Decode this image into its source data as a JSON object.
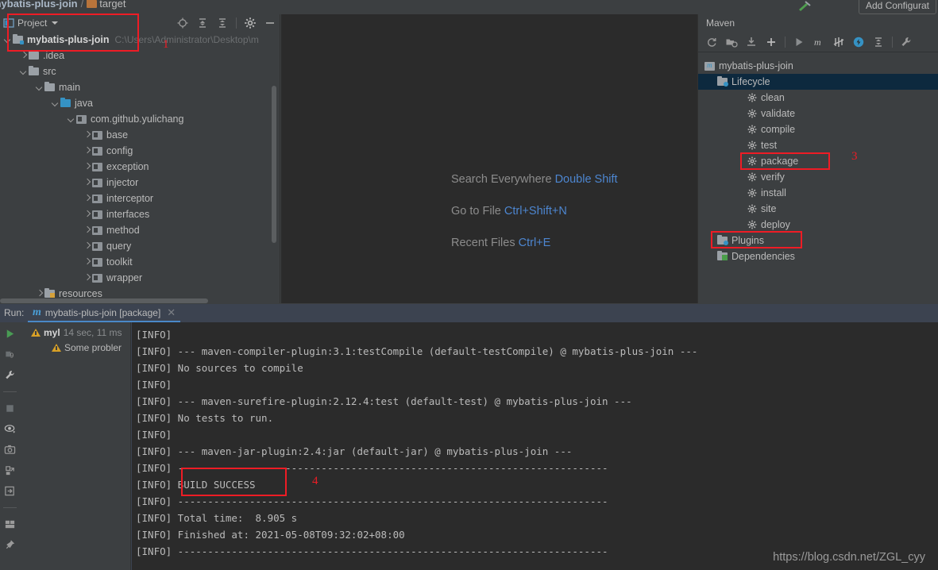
{
  "breadcrumb": {
    "project": "mybatis-plus-join",
    "separator": "/",
    "target": "target"
  },
  "toolbar": {
    "add_configuration": "Add Configurat",
    "hammer_icon": "build-hammer-icon"
  },
  "project_panel": {
    "title": "Project",
    "icons": [
      "locate-icon",
      "expand-all-icon",
      "collapse-all-icon",
      "settings-gear-icon",
      "hide-minimize-icon"
    ],
    "root": {
      "label": "mybatis-plus-join",
      "path": "C:\\Users\\Administrator\\Desktop\\m"
    },
    "items": [
      {
        "label": ".idea",
        "indent": 2,
        "arrow": "right",
        "icon": "folder-grey"
      },
      {
        "label": "src",
        "indent": 2,
        "arrow": "down",
        "icon": "folder-grey"
      },
      {
        "label": "main",
        "indent": 3,
        "arrow": "down",
        "icon": "folder-grey"
      },
      {
        "label": "java",
        "indent": 4,
        "arrow": "down",
        "icon": "folder-blue"
      },
      {
        "label": "com.github.yulichang",
        "indent": 5,
        "arrow": "down",
        "icon": "package"
      },
      {
        "label": "base",
        "indent": 6,
        "arrow": "right",
        "icon": "package"
      },
      {
        "label": "config",
        "indent": 6,
        "arrow": "right",
        "icon": "package"
      },
      {
        "label": "exception",
        "indent": 6,
        "arrow": "right",
        "icon": "package"
      },
      {
        "label": "injector",
        "indent": 6,
        "arrow": "right",
        "icon": "package"
      },
      {
        "label": "interceptor",
        "indent": 6,
        "arrow": "right",
        "icon": "package"
      },
      {
        "label": "interfaces",
        "indent": 6,
        "arrow": "right",
        "icon": "package"
      },
      {
        "label": "method",
        "indent": 6,
        "arrow": "right",
        "icon": "package"
      },
      {
        "label": "query",
        "indent": 6,
        "arrow": "right",
        "icon": "package"
      },
      {
        "label": "toolkit",
        "indent": 6,
        "arrow": "right",
        "icon": "package"
      },
      {
        "label": "wrapper",
        "indent": 6,
        "arrow": "right",
        "icon": "package"
      },
      {
        "label": "resources",
        "indent": 3,
        "arrow": "right",
        "icon": "folder-resources"
      }
    ]
  },
  "editor": {
    "shortcuts": [
      {
        "action": "Search Everywhere",
        "key": "Double Shift"
      },
      {
        "action": "Go to File",
        "key": "Ctrl+Shift+N"
      },
      {
        "action": "Recent Files",
        "key": "Ctrl+E"
      }
    ]
  },
  "maven_panel": {
    "title": "Maven",
    "toolbar_icons": [
      "reload-icon",
      "add-maven-project-icon",
      "download-sources-icon",
      "plus-icon",
      "run-icon",
      "maven-goal-icon",
      "toggle-skip-tests-icon",
      "execute-icon",
      "collapse-all-icon",
      "settings-wrench-icon"
    ],
    "project": "mybatis-plus-join",
    "lifecycle_label": "Lifecycle",
    "goals": [
      "clean",
      "validate",
      "compile",
      "test",
      "package",
      "verify",
      "install",
      "site",
      "deploy"
    ],
    "plugins_label": "Plugins",
    "dependencies_label": "Dependencies"
  },
  "run_panel": {
    "run_label": "Run:",
    "tab_title": "mybatis-plus-join [package]",
    "tab_close": "✕",
    "sidebar_icons": [
      "rerun-icon",
      "debug-icon",
      "settings-wrench-icon",
      "stop-icon",
      "toggle-soft-wrap-icon",
      "screenshot-icon",
      "thread-dump-icon",
      "export-icon",
      "layout-icon",
      "pin-icon"
    ],
    "tree": [
      {
        "label": "myl",
        "meta": "14 sec, 11 ms",
        "indent": 1,
        "arrow": "down",
        "icon": "warning-icon"
      },
      {
        "label": "Some probler",
        "meta": "",
        "indent": 2,
        "arrow": "none",
        "icon": "warning-icon"
      }
    ],
    "console_lines": [
      "[INFO]",
      "[INFO] --- maven-compiler-plugin:3.1:testCompile (default-testCompile) @ mybatis-plus-join ---",
      "[INFO] No sources to compile",
      "[INFO]",
      "[INFO] --- maven-surefire-plugin:2.12.4:test (default-test) @ mybatis-plus-join ---",
      "[INFO] No tests to run.",
      "[INFO]",
      "[INFO] --- maven-jar-plugin:2.4:jar (default-jar) @ mybatis-plus-join ---",
      "[INFO] ------------------------------------------------------------------------",
      "[INFO] BUILD SUCCESS",
      "[INFO] ------------------------------------------------------------------------",
      "[INFO] Total time:  8.905 s",
      "[INFO] Finished at: 2021-05-08T09:32:02+08:00",
      "[INFO] ------------------------------------------------------------------------"
    ]
  },
  "annotations": {
    "numbers": [
      "1",
      "3",
      "4"
    ],
    "box_color": "#ee1c25"
  },
  "watermark": "https://blog.csdn.net/ZGL_cyy",
  "colors": {
    "editor_background": "#2b2b2b",
    "panel_background": "#3c3f41",
    "run_panel_background": "#3c4350",
    "selection_blue": "#0d293e",
    "accent_blue": "#4d86d0",
    "annotation_red": "#ee1c25"
  }
}
